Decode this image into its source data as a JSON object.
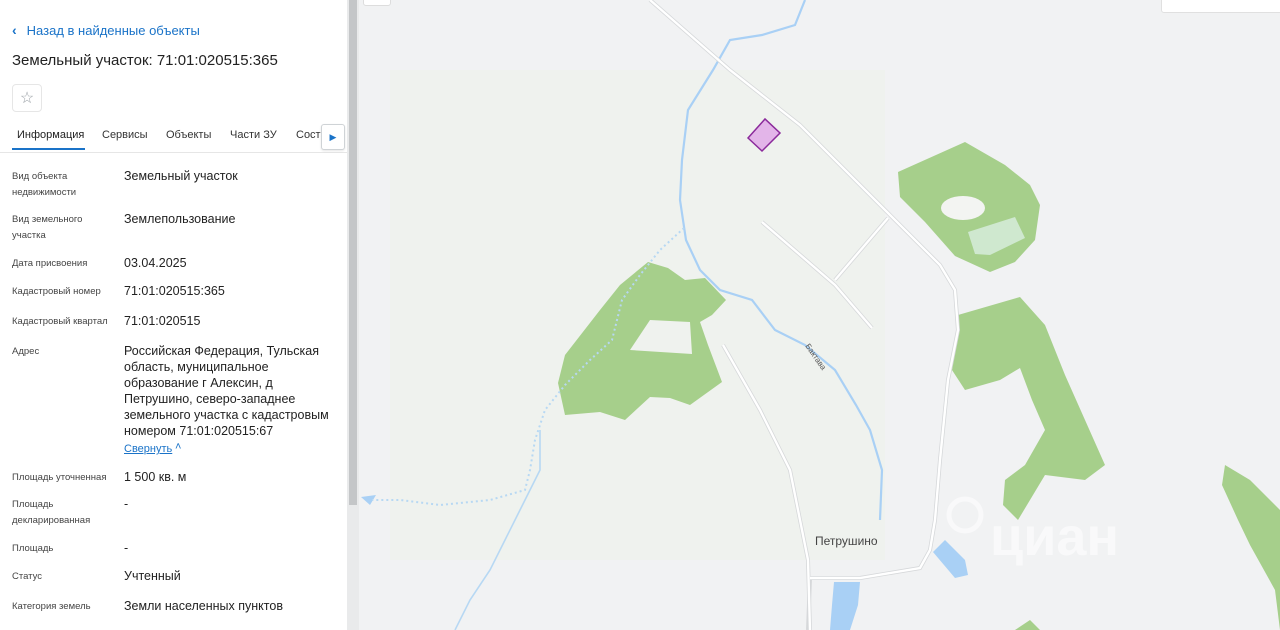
{
  "panel": {
    "back_label": "Назад в найденные объекты",
    "title": "Земельный участок: 71:01:020515:365",
    "star_icon": "star-outline-icon",
    "tabs": [
      {
        "label": "Информация"
      },
      {
        "label": "Сервисы"
      },
      {
        "label": "Объекты"
      },
      {
        "label": "Части ЗУ"
      },
      {
        "label": "Соста"
      }
    ],
    "rows": [
      {
        "label": "Вид объекта недвижимости",
        "value": "Земельный участок"
      },
      {
        "label": "Вид земельного участка",
        "value": "Землепользование"
      },
      {
        "label": "Дата присвоения",
        "value": "03.04.2025"
      },
      {
        "label": "Кадастровый номер",
        "value": "71:01:020515:365"
      },
      {
        "label": "Кадастровый квартал",
        "value": "71:01:020515"
      },
      {
        "label": "Адрес",
        "value": "Российская Федерация, Тульская область, муниципальное образование г Алексин, д Петрушино, северо-западнее земельного участка с кадастровым номером 71:01:020515:67"
      },
      {
        "label": "Площадь уточненная",
        "value": "1 500 кв. м"
      },
      {
        "label": "Площадь декларированная",
        "value": "-"
      },
      {
        "label": "Площадь",
        "value": "-"
      },
      {
        "label": "Статус",
        "value": "Учтенный"
      },
      {
        "label": "Категория земель",
        "value": "Земли населенных пунктов"
      }
    ],
    "collapse_label": "Свернуть"
  },
  "map": {
    "village_label": "Петрушино",
    "river_label": "Бактава",
    "watermark": "циан",
    "colors": {
      "forest": "#a6cf8b",
      "water": "#a9d0f5",
      "road": "#ffffff",
      "parcel_fill": "#e3b5e9",
      "parcel_stroke": "#8b2a9b",
      "background": "#f1f2f3"
    }
  }
}
